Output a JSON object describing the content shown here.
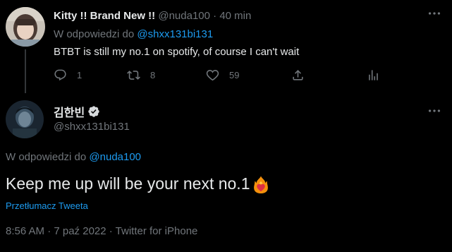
{
  "reply_tweet": {
    "display_name": "Kitty !! Brand New !!",
    "handle": "@nuda100",
    "separator": "·",
    "time": "40 min",
    "replying_prefix": "W odpowiedzi do",
    "replying_to": "@shxx131bi131",
    "text": "BTBT is still my no.1 on spotify, of course I can't wait",
    "actions": {
      "reply_icon": "reply-icon",
      "reply_count": "1",
      "retweet_icon": "retweet-icon",
      "retweet_count": "8",
      "like_icon": "heart-icon",
      "like_count": "59",
      "share_icon": "share-icon",
      "analytics_icon": "analytics-icon"
    }
  },
  "main_tweet": {
    "display_name": "김한빈",
    "verified_icon": "verified-badge-icon",
    "handle": "@shxx131bi131",
    "replying_prefix": "W odpowiedzi do",
    "replying_to": "@nuda100",
    "text": "Keep me up will be your next no.1",
    "emoji_icon": "fire-heart-emoji-icon",
    "translate_label": "Przetłumacz Tweeta",
    "meta": "8:56 AM · 7 paź 2022 · Twitter for iPhone"
  },
  "colors": {
    "background": "#000000",
    "text_primary": "#e7e9ea",
    "text_secondary": "#71767b",
    "link": "#1d9bf0",
    "verified": "#d6d9db"
  }
}
